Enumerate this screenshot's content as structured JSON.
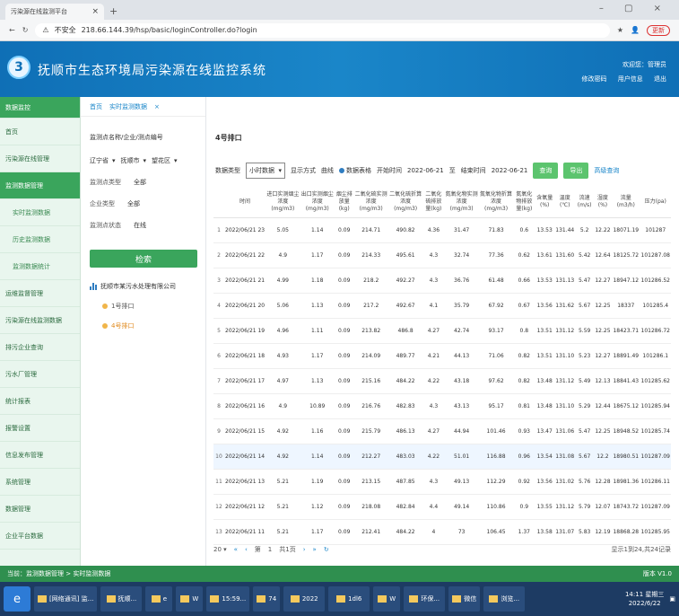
{
  "browser": {
    "tab_title": "污染源在线监测平台",
    "address": "218.66.144.39/hsp/basic/loginController.do?login",
    "security_label": "不安全",
    "update_badge": "更新"
  },
  "app": {
    "title": "抚顺市生态环境局污染源在线监控系统",
    "user_info": "欢迎您：管理员",
    "links": [
      "修改密码",
      "用户信息",
      "退出"
    ]
  },
  "sidebar": {
    "items": [
      {
        "label": "数据监控",
        "type": "head"
      },
      {
        "label": "首页",
        "type": "normal"
      },
      {
        "label": "污染源在线管理",
        "type": "normal"
      },
      {
        "label": "监测数据管理",
        "type": "active"
      },
      {
        "label": "实时监测数据",
        "type": "sub"
      },
      {
        "label": "历史监测数据",
        "type": "sub"
      },
      {
        "label": "监测数据统计",
        "type": "sub"
      },
      {
        "label": "运维监督管理",
        "type": "normal"
      },
      {
        "label": "污染源在线监测数据",
        "type": "normal"
      },
      {
        "label": "排污企业查询",
        "type": "normal"
      },
      {
        "label": "污水厂管理",
        "type": "normal"
      },
      {
        "label": "统计报表",
        "type": "normal"
      },
      {
        "label": "报警设置",
        "type": "normal"
      },
      {
        "label": "信息发布管理",
        "type": "normal"
      },
      {
        "label": "系统管理",
        "type": "normal"
      },
      {
        "label": "数据管理",
        "type": "normal"
      },
      {
        "label": "企业平台数据",
        "type": "normal"
      }
    ]
  },
  "breadcrumb": {
    "home": "首页",
    "current": "实时监测数据"
  },
  "tree": {
    "title": "监测点名称/企业/测点编号",
    "selects": [
      "辽宁省",
      "抚顺市",
      "望花区"
    ],
    "fields": [
      {
        "label": "监测点类型",
        "value": "全部"
      },
      {
        "label": "企业类型",
        "value": "全部"
      },
      {
        "label": "监测点状态",
        "value": "在线"
      }
    ],
    "query_button": "检索",
    "root": "抚顺市某污水处理有限公司",
    "nodes": [
      "1号排口",
      "4号排口"
    ]
  },
  "main": {
    "title": "4号排口",
    "filter": {
      "data_type_label": "数据类型",
      "data_type_value": "小时数据",
      "display_label": "显示方式",
      "display_options": [
        "曲线",
        "数据表格"
      ],
      "time_label": "开始时间",
      "start": "2022-06-21",
      "to": "至",
      "end_label": "结束时间",
      "end": "2022-06-21",
      "query": "查询",
      "export": "导出",
      "link": "高级查询"
    },
    "columns": [
      "",
      "时间",
      "进口实测烟尘浓度(mg/m3)",
      "出口实测烟尘浓度(mg/m3)",
      "烟尘排放量(kg)",
      "二氧化硫实测浓度(mg/m3)",
      "二氧化硫折算浓度(mg/m3)",
      "二氧化硫排放量(kg)",
      "氮氧化物实测浓度(mg/m3)",
      "氮氧化物折算浓度(mg/m3)",
      "氮氧化物排放量(kg)",
      "含氧量(%)",
      "温度(℃)",
      "流速(m/s)",
      "湿度(%)",
      "流量(m3/h)",
      "压力(pa)"
    ],
    "rows": [
      [
        "1",
        "2022/06/21 23",
        "5.05",
        "1.14",
        "0.09",
        "214.71",
        "490.82",
        "4.36",
        "31.47",
        "71.83",
        "0.6",
        "13.53",
        "131.44",
        "5.2",
        "12.22",
        "18071.19",
        "101287"
      ],
      [
        "2",
        "2022/06/21 22",
        "4.9",
        "1.17",
        "0.09",
        "214.33",
        "495.61",
        "4.3",
        "32.74",
        "77.36",
        "0.62",
        "13.61",
        "131.60",
        "5.42",
        "12.64",
        "18125.72",
        "101287.08"
      ],
      [
        "3",
        "2022/06/21 21",
        "4.99",
        "1.18",
        "0.09",
        "218.2",
        "492.27",
        "4.3",
        "36.76",
        "61.48",
        "0.66",
        "13.53",
        "131.13",
        "5.47",
        "12.27",
        "18947.12",
        "101286.52"
      ],
      [
        "4",
        "2022/06/21 20",
        "5.06",
        "1.13",
        "0.09",
        "217.2",
        "492.67",
        "4.1",
        "35.79",
        "67.92",
        "0.67",
        "13.56",
        "131.62",
        "5.67",
        "12.25",
        "18337",
        "101285.4"
      ],
      [
        "5",
        "2022/06/21 19",
        "4.96",
        "1.11",
        "0.09",
        "213.82",
        "486.8",
        "4.27",
        "42.74",
        "93.17",
        "0.8",
        "13.51",
        "131.12",
        "5.59",
        "12.25",
        "18423.71",
        "101286.72"
      ],
      [
        "6",
        "2022/06/21 18",
        "4.93",
        "1.17",
        "0.09",
        "214.09",
        "489.77",
        "4.21",
        "44.13",
        "71.06",
        "0.82",
        "13.51",
        "131.10",
        "5.23",
        "12.27",
        "18891.49",
        "101286.1"
      ],
      [
        "7",
        "2022/06/21 17",
        "4.97",
        "1.13",
        "0.09",
        "215.16",
        "484.22",
        "4.22",
        "43.18",
        "97.62",
        "0.82",
        "13.48",
        "131.12",
        "5.49",
        "12.13",
        "18841.43",
        "101285.62"
      ],
      [
        "8",
        "2022/06/21 16",
        "4.9",
        "10.89",
        "0.09",
        "216.76",
        "482.83",
        "4.3",
        "43.13",
        "95.17",
        "0.81",
        "13.48",
        "131.10",
        "5.29",
        "12.44",
        "18675.12",
        "101285.94"
      ],
      [
        "9",
        "2022/06/21 15",
        "4.92",
        "1.16",
        "0.09",
        "215.79",
        "486.13",
        "4.27",
        "44.94",
        "101.46",
        "0.93",
        "13.47",
        "131.06",
        "5.47",
        "12.25",
        "18948.52",
        "101285.74"
      ],
      [
        "10",
        "2022/06/21 14",
        "4.92",
        "1.14",
        "0.09",
        "212.27",
        "483.03",
        "4.22",
        "51.01",
        "116.88",
        "0.96",
        "13.54",
        "131.08",
        "5.67",
        "12.2",
        "18980.51",
        "101287.09"
      ],
      [
        "11",
        "2022/06/21 13",
        "5.21",
        "1.19",
        "0.09",
        "213.15",
        "487.85",
        "4.3",
        "49.13",
        "112.29",
        "0.92",
        "13.56",
        "131.02",
        "5.76",
        "12.28",
        "18981.36",
        "101286.11"
      ],
      [
        "12",
        "2022/06/21 12",
        "5.21",
        "1.12",
        "0.09",
        "218.08",
        "482.84",
        "4.4",
        "49.14",
        "110.86",
        "0.9",
        "13.55",
        "131.12",
        "5.79",
        "12.07",
        "18743.72",
        "101287.09"
      ],
      [
        "13",
        "2022/06/21 11",
        "5.21",
        "1.17",
        "0.09",
        "212.41",
        "484.22",
        "4",
        "73",
        "106.45",
        "1.37",
        "13.58",
        "131.07",
        "5.83",
        "12.19",
        "18868.28",
        "101285.95"
      ]
    ],
    "highlight_row": 9,
    "pager": {
      "size": "20",
      "first": "«",
      "prev": "‹",
      "page_label": "第",
      "page": "1",
      "total_label": "共1页",
      "next": "›",
      "last": "»",
      "refresh": "↻",
      "info": "显示1到24,共24记录"
    }
  },
  "statusbar": {
    "left": "当前：监测数据管理 > 实时监测数据",
    "version": "版本 V1.0"
  },
  "taskbar": {
    "apps": [
      "[网络通讯] 监...",
      "抚顺...",
      "e",
      "W",
      "15:59...",
      "74",
      "2022",
      "1dl6",
      "W",
      "环保...",
      "微信",
      "浏览..."
    ],
    "time": "14:11 星期三",
    "date": "2022/6/22"
  }
}
